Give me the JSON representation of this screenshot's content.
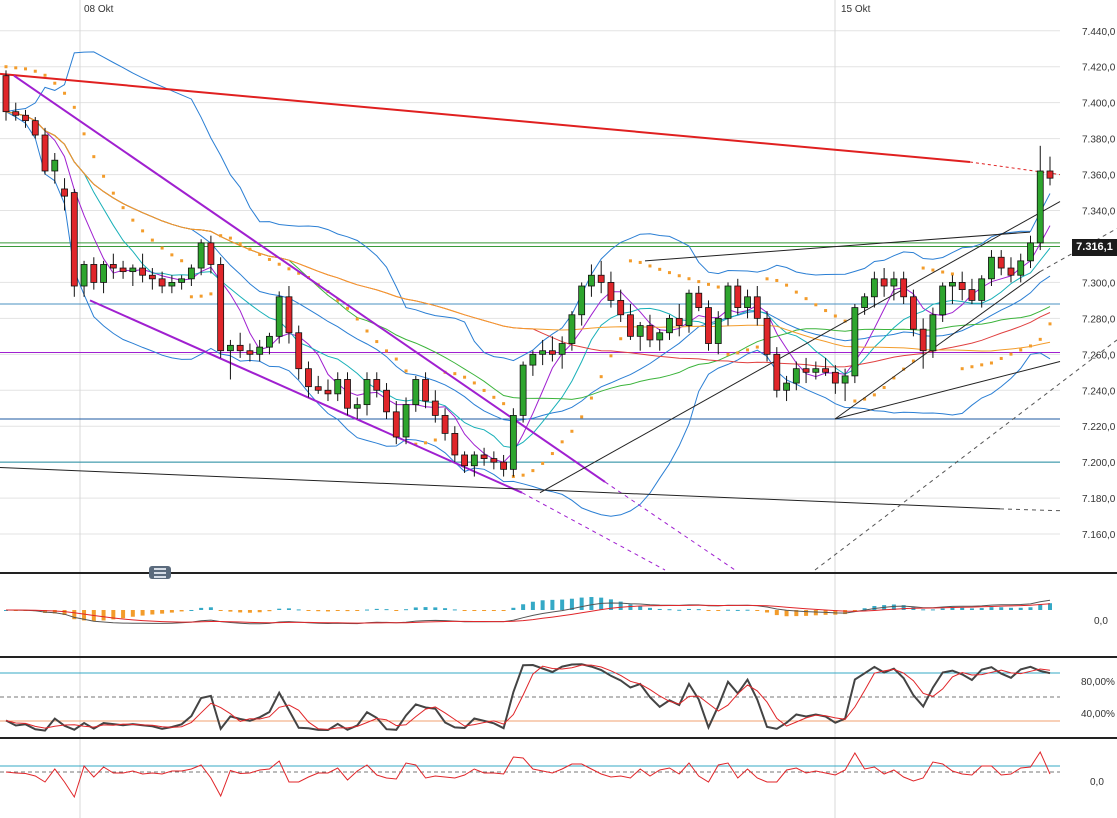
{
  "price_axis": {
    "ticks": [
      "7.440,0",
      "7.420,0",
      "7.400,0",
      "7.380,0",
      "7.360,0",
      "7.340,0",
      "7.320,0",
      "7.300,0",
      "7.280,0",
      "7.260,0",
      "7.240,0",
      "7.220,0",
      "7.200,0",
      "7.180,0",
      "7.160,0"
    ],
    "last_price": "7.316,1"
  },
  "date_labels": [
    "08 Okt",
    "15 Okt"
  ],
  "panels": {
    "macd": {
      "tick": "0,0"
    },
    "stochastic": {
      "ticks": [
        "80,00%",
        "40,00%"
      ]
    },
    "momentum": {
      "tick": "0,0"
    }
  },
  "colors": {
    "up": "#2ea52e",
    "down": "#e0262a",
    "bollinger": "#2b7fd4",
    "channel": "#a020d0",
    "resistance": "#e02020",
    "sar": "#f39c2b",
    "sma_fast": "#18b0b8",
    "sma_mid": "#3cb43c",
    "sma_slow": "#e04040"
  },
  "chart_data": {
    "type": "candlestick",
    "y_range": [
      7140,
      7446
    ],
    "candles": [
      [
        7415,
        7418,
        7390,
        7395
      ],
      [
        7395,
        7400,
        7390,
        7393
      ],
      [
        7393,
        7396,
        7386,
        7390
      ],
      [
        7390,
        7392,
        7380,
        7382
      ],
      [
        7382,
        7386,
        7360,
        7362
      ],
      [
        7362,
        7372,
        7355,
        7368
      ],
      [
        7352,
        7358,
        7340,
        7348
      ],
      [
        7350,
        7352,
        7292,
        7298
      ],
      [
        7298,
        7312,
        7292,
        7310
      ],
      [
        7310,
        7314,
        7296,
        7300
      ],
      [
        7300,
        7312,
        7294,
        7310
      ],
      [
        7310,
        7316,
        7302,
        7308
      ],
      [
        7308,
        7312,
        7302,
        7306
      ],
      [
        7306,
        7310,
        7298,
        7308
      ],
      [
        7308,
        7316,
        7300,
        7304
      ],
      [
        7304,
        7308,
        7296,
        7302
      ],
      [
        7302,
        7306,
        7294,
        7298
      ],
      [
        7298,
        7304,
        7294,
        7300
      ],
      [
        7300,
        7304,
        7296,
        7302
      ],
      [
        7302,
        7310,
        7298,
        7308
      ],
      [
        7308,
        7324,
        7304,
        7322
      ],
      [
        7322,
        7326,
        7305,
        7310
      ],
      [
        7310,
        7314,
        7258,
        7262
      ],
      [
        7262,
        7268,
        7246,
        7265
      ],
      [
        7265,
        7272,
        7258,
        7262
      ],
      [
        7262,
        7266,
        7256,
        7260
      ],
      [
        7260,
        7268,
        7256,
        7264
      ],
      [
        7264,
        7272,
        7260,
        7270
      ],
      [
        7270,
        7295,
        7266,
        7292
      ],
      [
        7292,
        7298,
        7266,
        7272
      ],
      [
        7272,
        7276,
        7246,
        7252
      ],
      [
        7252,
        7256,
        7236,
        7242
      ],
      [
        7242,
        7248,
        7238,
        7240
      ],
      [
        7240,
        7246,
        7234,
        7238
      ],
      [
        7238,
        7250,
        7234,
        7246
      ],
      [
        7246,
        7250,
        7226,
        7230
      ],
      [
        7230,
        7236,
        7224,
        7232
      ],
      [
        7232,
        7250,
        7226,
        7246
      ],
      [
        7246,
        7250,
        7236,
        7240
      ],
      [
        7240,
        7244,
        7224,
        7228
      ],
      [
        7228,
        7234,
        7210,
        7214
      ],
      [
        7214,
        7236,
        7210,
        7232
      ],
      [
        7232,
        7248,
        7228,
        7246
      ],
      [
        7246,
        7250,
        7230,
        7234
      ],
      [
        7234,
        7240,
        7222,
        7226
      ],
      [
        7226,
        7230,
        7212,
        7216
      ],
      [
        7216,
        7220,
        7200,
        7204
      ],
      [
        7204,
        7206,
        7194,
        7198
      ],
      [
        7198,
        7206,
        7192,
        7204
      ],
      [
        7204,
        7208,
        7198,
        7202
      ],
      [
        7202,
        7206,
        7196,
        7200
      ],
      [
        7200,
        7204,
        7192,
        7196
      ],
      [
        7196,
        7230,
        7192,
        7226
      ],
      [
        7226,
        7256,
        7222,
        7254
      ],
      [
        7254,
        7262,
        7248,
        7260
      ],
      [
        7260,
        7268,
        7254,
        7262
      ],
      [
        7262,
        7270,
        7256,
        7260
      ],
      [
        7260,
        7270,
        7252,
        7266
      ],
      [
        7266,
        7284,
        7262,
        7282
      ],
      [
        7282,
        7300,
        7276,
        7298
      ],
      [
        7298,
        7310,
        7292,
        7304
      ],
      [
        7304,
        7312,
        7294,
        7300
      ],
      [
        7300,
        7306,
        7286,
        7290
      ],
      [
        7290,
        7296,
        7278,
        7282
      ],
      [
        7282,
        7288,
        7268,
        7270
      ],
      [
        7270,
        7278,
        7262,
        7276
      ],
      [
        7276,
        7282,
        7264,
        7268
      ],
      [
        7268,
        7274,
        7262,
        7272
      ],
      [
        7272,
        7282,
        7268,
        7280
      ],
      [
        7280,
        7288,
        7270,
        7276
      ],
      [
        7276,
        7296,
        7272,
        7294
      ],
      [
        7294,
        7298,
        7284,
        7286
      ],
      [
        7286,
        7290,
        7262,
        7266
      ],
      [
        7266,
        7284,
        7260,
        7280
      ],
      [
        7280,
        7300,
        7276,
        7298
      ],
      [
        7298,
        7302,
        7282,
        7286
      ],
      [
        7286,
        7296,
        7280,
        7292
      ],
      [
        7292,
        7298,
        7276,
        7280
      ],
      [
        7280,
        7284,
        7256,
        7260
      ],
      [
        7260,
        7264,
        7236,
        7240
      ],
      [
        7240,
        7248,
        7234,
        7244
      ],
      [
        7244,
        7256,
        7240,
        7252
      ],
      [
        7252,
        7258,
        7244,
        7250
      ],
      [
        7250,
        7256,
        7246,
        7252
      ],
      [
        7252,
        7258,
        7248,
        7250
      ],
      [
        7250,
        7254,
        7238,
        7244
      ],
      [
        7244,
        7252,
        7234,
        7248
      ],
      [
        7248,
        7288,
        7244,
        7286
      ],
      [
        7286,
        7294,
        7282,
        7292
      ],
      [
        7292,
        7306,
        7286,
        7302
      ],
      [
        7302,
        7308,
        7292,
        7298
      ],
      [
        7298,
        7306,
        7290,
        7302
      ],
      [
        7302,
        7306,
        7288,
        7292
      ],
      [
        7292,
        7296,
        7270,
        7274
      ],
      [
        7274,
        7280,
        7252,
        7262
      ],
      [
        7262,
        7286,
        7258,
        7282
      ],
      [
        7282,
        7300,
        7278,
        7298
      ],
      [
        7298,
        7304,
        7288,
        7300
      ],
      [
        7300,
        7306,
        7290,
        7296
      ],
      [
        7296,
        7302,
        7288,
        7290
      ],
      [
        7290,
        7304,
        7286,
        7302
      ],
      [
        7302,
        7318,
        7298,
        7314
      ],
      [
        7314,
        7318,
        7304,
        7308
      ],
      [
        7308,
        7314,
        7300,
        7304
      ],
      [
        7304,
        7316,
        7300,
        7312
      ],
      [
        7312,
        7326,
        7308,
        7322
      ],
      [
        7322,
        7376,
        7318,
        7362
      ],
      [
        7362,
        7370,
        7354,
        7358
      ]
    ]
  }
}
